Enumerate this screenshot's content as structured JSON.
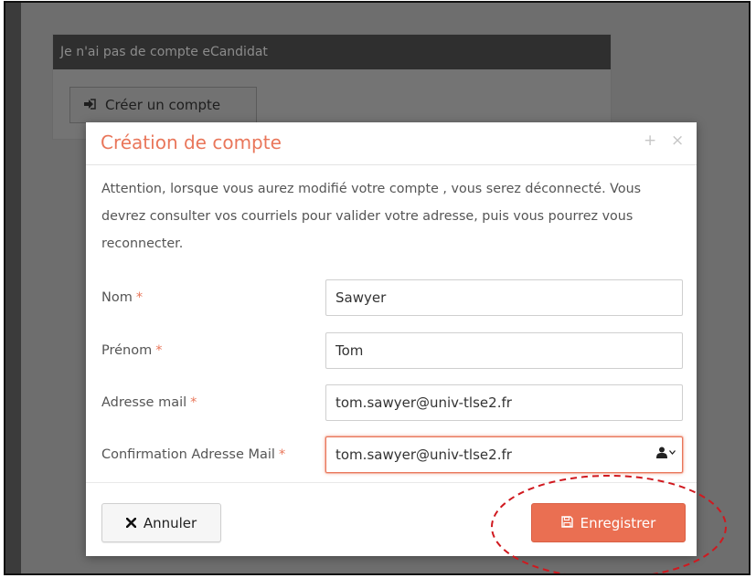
{
  "background": {
    "panel_title": "Je n'ai pas de compte eCandidat",
    "create_account_label": "Créer un compte"
  },
  "modal": {
    "title": "Création de compte",
    "notice": "Attention, lorsque vous aurez modifié votre compte , vous serez déconnecté. Vous devrez consulter vos courriels pour valider votre adresse, puis vous pourrez vous reconnecter.",
    "fields": [
      {
        "label": "Nom",
        "value": "Sawyer"
      },
      {
        "label": "Prénom",
        "value": "Tom"
      },
      {
        "label": "Adresse mail",
        "value": "tom.sawyer@univ-tlse2.fr"
      },
      {
        "label": "Confirmation Adresse Mail",
        "value": "tom.sawyer@univ-tlse2.fr"
      }
    ],
    "required_marker": "*",
    "cancel_label": "Annuler",
    "save_label": "Enregistrer"
  },
  "icons": {
    "maximize": "plus-icon",
    "close": "close-icon",
    "sign-in": "sign-in-icon",
    "cancel": "times-icon",
    "save": "floppy-disk-icon",
    "autofill": "user-icon"
  },
  "colors": {
    "accent": "#e9765a",
    "save_button": "#ea6f52",
    "annotation": "#d0191f"
  }
}
